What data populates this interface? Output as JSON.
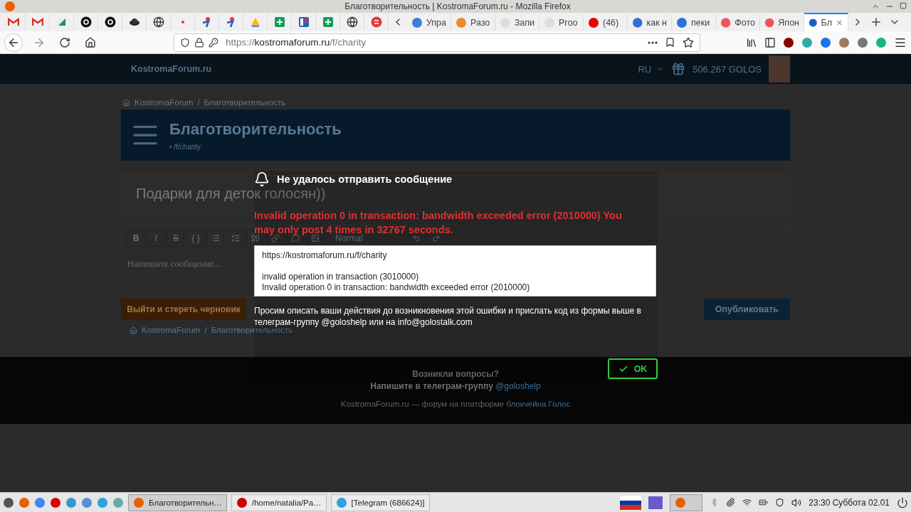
{
  "window": {
    "title": "Благотворительность | KostromaForum.ru - Mozilla Firefox"
  },
  "pinned_tabs": [
    {
      "selected": false
    },
    {
      "selected": false
    },
    {
      "selected": false
    },
    {
      "selected": false
    },
    {
      "selected": false
    },
    {
      "selected": false
    },
    {
      "selected": false
    },
    {
      "selected": false
    },
    {
      "selected": false
    },
    {
      "selected": false
    },
    {
      "selected": false
    },
    {
      "selected": false
    },
    {
      "selected": false
    },
    {
      "selected": false
    },
    {
      "selected": false
    },
    {
      "selected": false
    }
  ],
  "tabs": [
    {
      "label": "Упра",
      "selected": false
    },
    {
      "label": "Разо",
      "selected": false
    },
    {
      "label": "Запи",
      "selected": false
    },
    {
      "label": "Proo",
      "selected": false
    },
    {
      "label": "(46)",
      "selected": false
    },
    {
      "label": "как н",
      "selected": false
    },
    {
      "label": "пеки",
      "selected": false
    },
    {
      "label": "Фото",
      "selected": false
    },
    {
      "label": "Япон",
      "selected": false
    },
    {
      "label": "Бл",
      "selected": true
    }
  ],
  "address_bar": {
    "url_prefix": "https://",
    "url_domain": "kostromaforum.ru",
    "url_path": "/f/charity"
  },
  "site": {
    "logo": "KostromaForum.ru",
    "language": "RU",
    "balance": "506.267 GOLOS",
    "breadcrumb_top": {
      "items": [
        "KostromaForum",
        "Благотворительность"
      ],
      "separator": "/"
    },
    "category_title": "Благотворительность",
    "category_path": "• /f/charity",
    "post_title": "Подарки для деток голосян))",
    "toolbar": [
      {
        "label": "B",
        "kind": "bold"
      },
      {
        "label": "I",
        "kind": "italic"
      },
      {
        "label": "S",
        "kind": "strike"
      },
      {
        "label": "{ }",
        "kind": "code"
      }
    ],
    "format_select": "Normal",
    "editor_placeholder": "Напишите сообщение...",
    "discard_button": "Выйти и стереть черновик",
    "publish_button": "Опубликовать",
    "breadcrumb_bottom": {
      "items": [
        "KostromaForum",
        "Благотворительность"
      ],
      "separator": "/"
    },
    "footer": {
      "question": "Возникли вопросы?",
      "telegram_text": "Напишите в телеграм-группу",
      "telegram_link": "@goloshelp",
      "platform_text": "KostromaForum.ru — форум на платформе",
      "platform_link": "блокчейна Голос"
    }
  },
  "dialog": {
    "title": "Не удалось отправить сообщение",
    "error": "Invalid operation 0 in transaction: bandwidth exceeded error (2010000) You may only post 4 times in 32767 seconds.",
    "details": "https://kostromaforum.ru/f/charity\n\ninvalid operation in transaction (3010000)\nInvalid operation 0 in transaction: bandwidth exceeded error (2010000)",
    "help": "Просим описать ваши действия до возникновения этой ошибки и прислать код из формы выше в телеграм-группу @goloshelp или на info@golostalk.com",
    "ok_button": "OK"
  },
  "taskbar": {
    "windows": [
      {
        "label": "Благотворительн…",
        "selected": true
      },
      {
        "label": "/home/natalia/Pa…",
        "selected": false
      },
      {
        "label": "[Telegram (686624)]",
        "selected": false
      }
    ],
    "clock": "23:30 Суббота 02.01"
  }
}
